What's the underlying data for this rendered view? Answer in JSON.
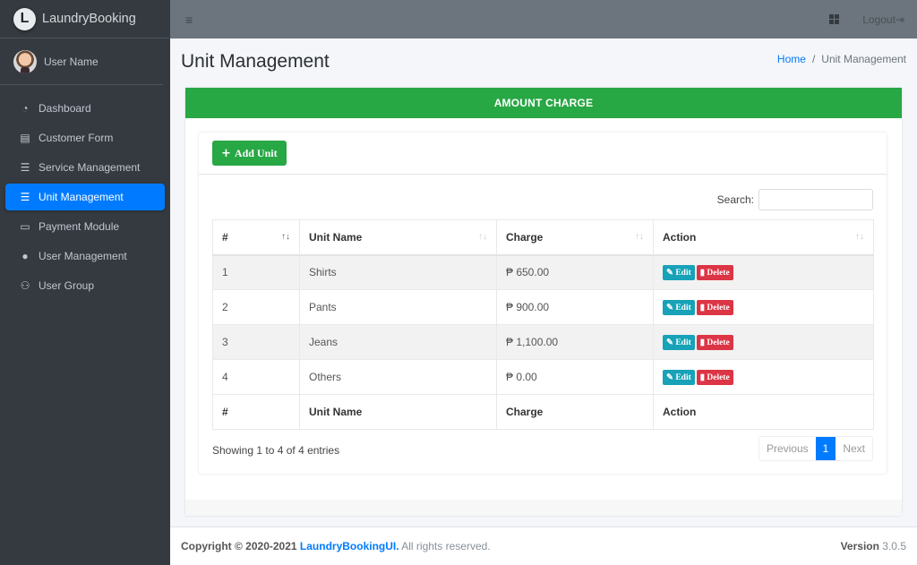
{
  "brand": {
    "logo_letter": "L",
    "name": "LaundryBooking"
  },
  "user": {
    "name": "User Name"
  },
  "sidebar": {
    "items": [
      {
        "label": "Dashboard",
        "icon": "tachometer-icon",
        "glyph": "◔",
        "active": false
      },
      {
        "label": "Customer Form",
        "icon": "id-card-icon",
        "glyph": "▤",
        "active": false
      },
      {
        "label": "Service Management",
        "icon": "list-icon",
        "glyph": "☰",
        "active": false
      },
      {
        "label": "Unit Management",
        "icon": "list-icon",
        "glyph": "☰",
        "active": true
      },
      {
        "label": "Payment Module",
        "icon": "money-bill-icon",
        "glyph": "▭",
        "active": false
      },
      {
        "label": "User Management",
        "icon": "user-icon",
        "glyph": "●",
        "active": false
      },
      {
        "label": "User Group",
        "icon": "users-icon",
        "glyph": "⚇",
        "active": false
      }
    ]
  },
  "navbar": {
    "menu_glyph": "≡",
    "logout_label": "Logout",
    "logout_glyph": "⇥"
  },
  "page": {
    "title": "Unit Management",
    "breadcrumb": {
      "home": "Home",
      "separator": "/",
      "current": "Unit Management"
    }
  },
  "card": {
    "header": "AMOUNT CHARGE",
    "add_button": {
      "plus": "+",
      "label": "Add Unit"
    },
    "search_label": "Search:",
    "search_value": "",
    "table": {
      "columns": [
        "#",
        "Unit Name",
        "Charge",
        "Action"
      ],
      "sort_glyphs": [
        "↑↓",
        "↑↓",
        "↑↓",
        "↑↓"
      ],
      "rows": [
        {
          "num": "1",
          "unit": "Shirts",
          "charge": "₱ 650.00"
        },
        {
          "num": "2",
          "unit": "Pants",
          "charge": "₱ 900.00"
        },
        {
          "num": "3",
          "unit": "Jeans",
          "charge": "₱ 1,100.00"
        },
        {
          "num": "4",
          "unit": "Others",
          "charge": "₱ 0.00"
        }
      ],
      "edit_label": "✎ Edit",
      "delete_label": "▮ Delete"
    },
    "info": "Showing 1 to 4 of 4 entries",
    "pagination": {
      "previous": "Previous",
      "current": "1",
      "next": "Next"
    }
  },
  "footer": {
    "copyright": "Copyright © 2020-2021",
    "brand_link": "LaundryBookingUI.",
    "rights": "All rights reserved.",
    "version_label": "Version",
    "version": "3.0.5"
  }
}
